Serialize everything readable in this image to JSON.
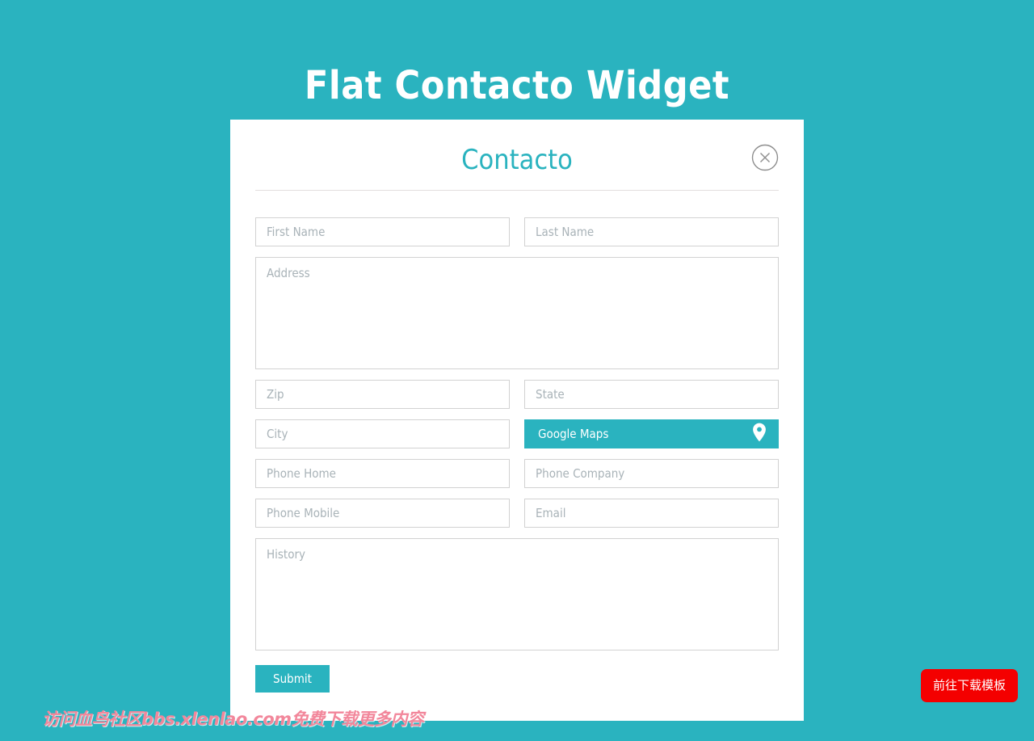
{
  "page": {
    "title": "Flat Contacto Widget",
    "background_color": "#2ab3bf",
    "accent_color": "#2ab3bf"
  },
  "card": {
    "title": "Contacto",
    "close_icon": "close-circle-icon"
  },
  "form": {
    "fields": [
      {
        "name": "first-name",
        "placeholder": "First Name",
        "value": ""
      },
      {
        "name": "last-name",
        "placeholder": "Last Name",
        "value": ""
      },
      {
        "name": "address",
        "placeholder": "Address",
        "value": ""
      },
      {
        "name": "zip",
        "placeholder": "Zip",
        "value": ""
      },
      {
        "name": "state",
        "placeholder": "State",
        "value": ""
      },
      {
        "name": "city",
        "placeholder": "City",
        "value": ""
      },
      {
        "name": "phone-home",
        "placeholder": "Phone Home",
        "value": ""
      },
      {
        "name": "phone-company",
        "placeholder": "Phone Company",
        "value": ""
      },
      {
        "name": "phone-mobile",
        "placeholder": "Phone Mobile",
        "value": ""
      },
      {
        "name": "email",
        "placeholder": "Email",
        "value": ""
      },
      {
        "name": "history",
        "placeholder": "History",
        "value": ""
      }
    ],
    "maps_button": {
      "label": "Google Maps",
      "icon": "map-pin-icon",
      "background_color": "#2ab3bf"
    },
    "submit_button": {
      "label": "Submit",
      "background_color": "#2ab3bf"
    }
  },
  "overlay": {
    "watermark": "访问血鸟社区bbs.xlenlao.com免费下载更多内容",
    "watermark_color": "#f2879b",
    "download_button": {
      "label": "前往下载模板",
      "background_color": "#f40000"
    }
  }
}
